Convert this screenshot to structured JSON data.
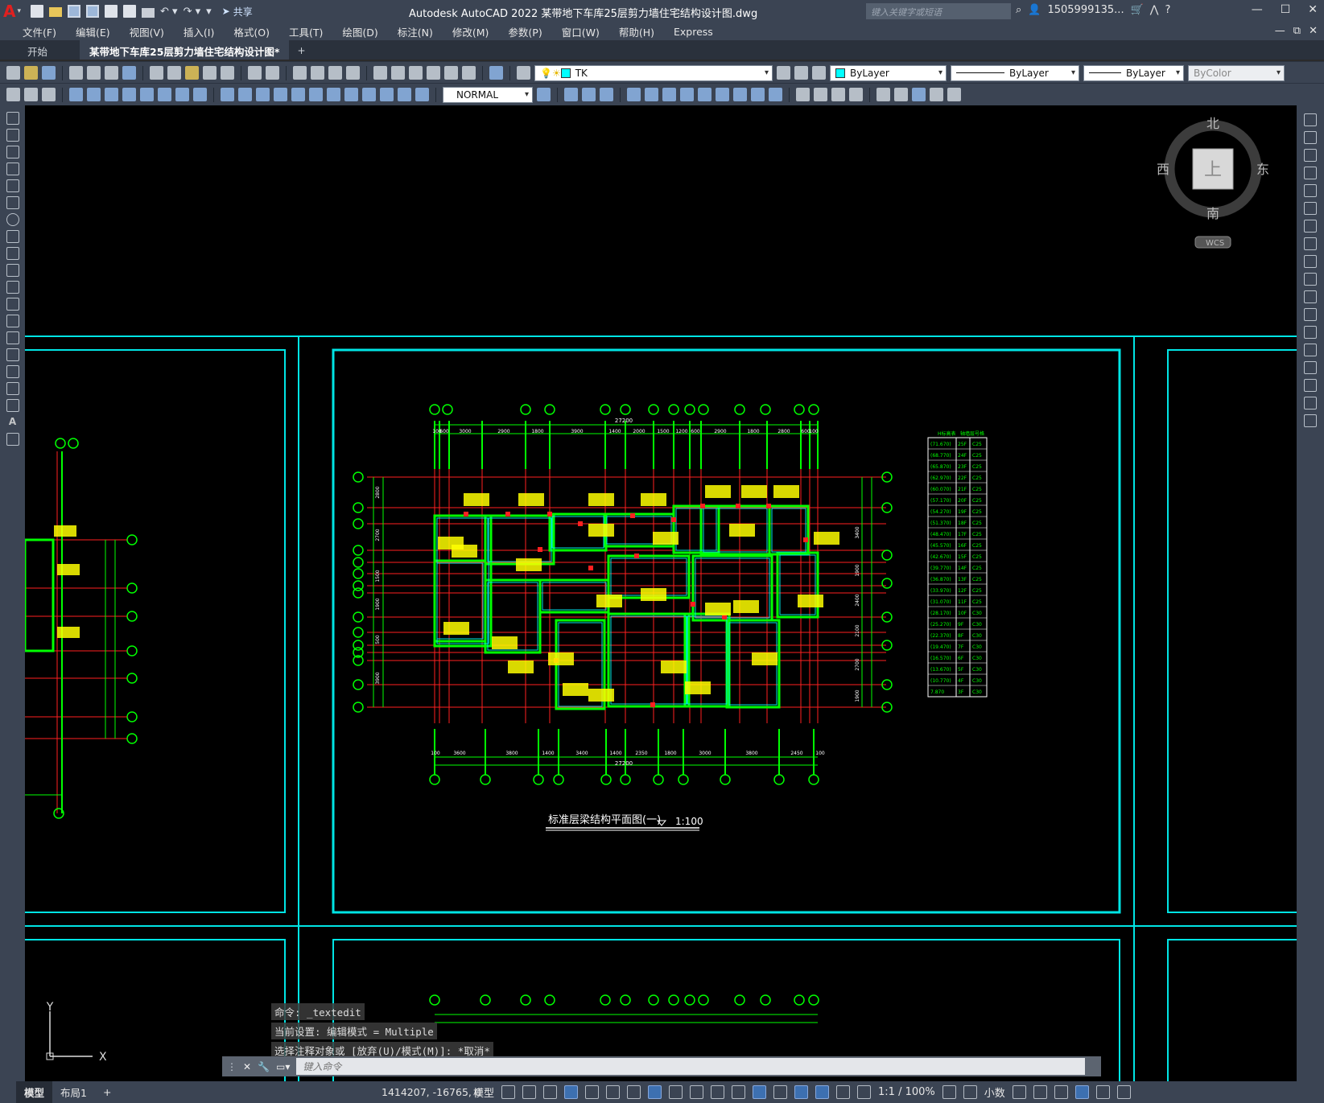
{
  "app": {
    "logo": "A",
    "title": "Autodesk AutoCAD 2022    某带地下车库25层剪力墙住宅结构设计图.dwg",
    "share": "共享",
    "search_placeholder": "键入关键字或短语",
    "user": "1505999135...",
    "window_controls": [
      "—",
      "☐",
      "✕"
    ]
  },
  "menu": {
    "items": [
      "文件(F)",
      "编辑(E)",
      "视图(V)",
      "插入(I)",
      "格式(O)",
      "工具(T)",
      "绘图(D)",
      "标注(N)",
      "修改(M)",
      "参数(P)",
      "窗口(W)",
      "帮助(H)",
      "Express"
    ],
    "right": [
      "—",
      "⧉",
      "✕"
    ]
  },
  "tabs": {
    "start": "开始",
    "doc": "某带地下车库25层剪力墙住宅结构设计图*",
    "plus": "+"
  },
  "toolbar": {
    "layer_name": "TK",
    "color": "ByLayer",
    "linetype": "ByLayer",
    "lineweight": "ByLayer",
    "plotstyle": "ByColor",
    "textstyle": "NORMAL",
    "layer_color": "#00ffff"
  },
  "viewcube": {
    "north": "北",
    "south": "南",
    "east": "东",
    "west": "西",
    "face": "上",
    "wcs": "WCS"
  },
  "drawing": {
    "title": "标准层梁结构平面图(一)",
    "scale": "1:100",
    "total_dim": "27200",
    "top_dims": [
      "100",
      "600",
      "3000",
      "2900",
      "1800",
      "3900",
      "1400",
      "2000",
      "1500",
      "1200",
      "600",
      "2900",
      "1800",
      "2800",
      "600",
      "100"
    ],
    "bottom_dims": [
      "100",
      "3600",
      "3800",
      "1400",
      "3400",
      "1400",
      "2350",
      "1800",
      "3000",
      "3800",
      "2450",
      "100"
    ],
    "left_dims": [
      "2800",
      "2700",
      "1500",
      "1900",
      "500",
      "3900"
    ],
    "right_dims": [
      "3400",
      "1900",
      "2400",
      "2100",
      "2700",
      "1900"
    ],
    "table_header": [
      "H标高表",
      "轴墙层号格",
      "混凝土"
    ],
    "table_rows": [
      [
        "(71.670)",
        "25F",
        "C25"
      ],
      [
        "(68.770)",
        "24F",
        "C25"
      ],
      [
        "(65.870)",
        "23F",
        "C25"
      ],
      [
        "(62.970)",
        "22F",
        "C25"
      ],
      [
        "(60.070)",
        "21F",
        "C25"
      ],
      [
        "(57.170)",
        "20F",
        "C25"
      ],
      [
        "(54.270)",
        "19F",
        "C25"
      ],
      [
        "(51.370)",
        "18F",
        "C25"
      ],
      [
        "(48.470)",
        "17F",
        "C25"
      ],
      [
        "(45.570)",
        "16F",
        "C25"
      ],
      [
        "(42.670)",
        "15F",
        "C25"
      ],
      [
        "(39.770)",
        "14F",
        "C25"
      ],
      [
        "(36.870)",
        "13F",
        "C25"
      ],
      [
        "(33.970)",
        "12F",
        "C25"
      ],
      [
        "(31.070)",
        "11F",
        "C25"
      ],
      [
        "(28.170)",
        "10F",
        "C30"
      ],
      [
        "(25.270)",
        "9F",
        "C30"
      ],
      [
        "(22.370)",
        "8F",
        "C30"
      ],
      [
        "(19.470)",
        "7F",
        "C30"
      ],
      [
        "(16.570)",
        "6F",
        "C30"
      ],
      [
        "(13.670)",
        "5F",
        "C30"
      ],
      [
        "(10.770)",
        "4F",
        "C30"
      ],
      [
        "7.870",
        "3F",
        "C30"
      ]
    ]
  },
  "command": {
    "history": [
      "命令: _textedit",
      "当前设置: 编辑模式 = Multiple",
      "选择注释对象或 [放弃(U)/模式(M)]: *取消*"
    ],
    "placeholder": "键入命令"
  },
  "status": {
    "model_tab": "模型",
    "layout_tab": "布局1",
    "plus": "+",
    "coords": "1414207, -16765, 0",
    "model": "模型",
    "scale": "1:1 / 100%",
    "units": "小数"
  }
}
